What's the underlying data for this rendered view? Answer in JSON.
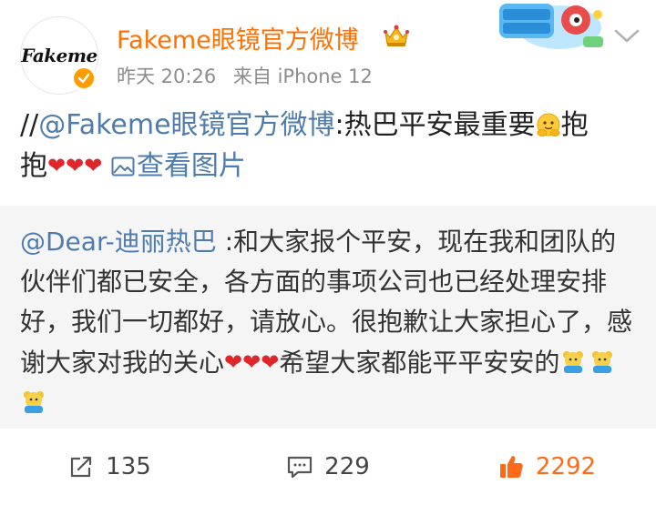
{
  "author": {
    "name": "Fakeme眼镜官方微博",
    "avatar_text": "Fakeme"
  },
  "meta": {
    "time": "昨天 20:26",
    "source": "来自 iPhone 12"
  },
  "post": {
    "prefix": "//",
    "mention": "@Fakeme眼镜官方微博",
    "text": ":热巴平安最重要",
    "line2_start": "抱",
    "line2_text": "抱",
    "view_images_label": "查看图片"
  },
  "repost": {
    "mention": "@Dear-迪丽热巴",
    "text": " :和大家报个平安，现在我和团队的伙伴们都已安全，各方面的事项公司也已经处理安排好，我们一切都好，请放心。很抱歉让大家担心了，感谢大家对我的关心",
    "text_after_hearts": "希望大家都能平平安安的"
  },
  "actions": {
    "repost_count": "135",
    "comment_count": "229",
    "like_count": "2292"
  },
  "colors": {
    "accent_orange": "#ff7000",
    "link_blue": "#4f7cae",
    "heart_red": "#e0262a",
    "like_orange": "#ff6a1a"
  },
  "icons": {
    "crown": "crown-icon",
    "verified": "verified-icon",
    "chevron": "chevron-down-icon",
    "picture": "picture-icon",
    "repost": "repost-icon",
    "comment": "comment-icon",
    "like": "thumbs-up-icon"
  }
}
